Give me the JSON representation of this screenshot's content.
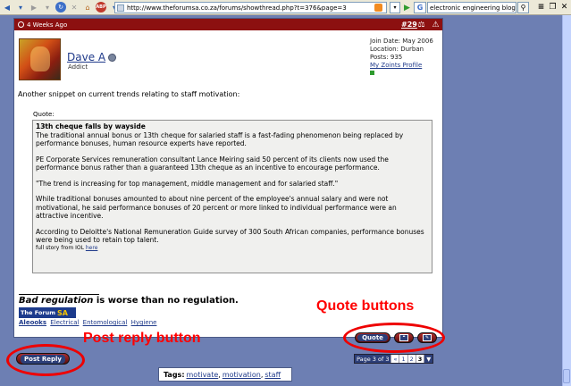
{
  "browser": {
    "url": "http://www.theforumsa.co.za/forums/showthread.php?t=376&page=3",
    "search_value": "electronic engineering blog",
    "search_engine_letter": "G",
    "addon_label": "ABP"
  },
  "post": {
    "time": "4 Weeks Ago",
    "number": "#29",
    "username": "Dave A",
    "user_title": "Addict",
    "join_date": "Join Date: May 2006",
    "location": "Location: Durban",
    "posts": "Posts: 935",
    "zoints_link": "My Zoints Profile",
    "intro": "Another snippet on current trends relating to staff motivation:",
    "quote_label": "Quote:",
    "quote": {
      "title": "13th cheque falls by wayside",
      "p1": "The traditional annual bonus or 13th cheque for salaried staff is a fast-fading phenomenon being replaced by performance bonuses, human resource experts have reported.",
      "p2": "PE Corporate Services remuneration consultant Lance Meiring said 50 percent of its clients now used the performance bonus rather than a guaranteed 13th cheque as an incentive to encourage performance.",
      "p3": "\"The trend is increasing for top management, middle management and for salaried staff.\"",
      "p4": "While traditional bonuses amounted to about nine percent of the employee's annual salary and were not motivational, he said performance bonuses of 20 percent or more linked to individual performance were an attractive incentive.",
      "p5": "According to Deloitte's National Remuneration Guide survey of 300 South African companies, performance bonuses were being used to retain top talent.",
      "source": "full story from IOL",
      "source_link": "here"
    },
    "signature": {
      "bold_italic": "Bad regulation",
      "rest": " is worse than no regulation.",
      "logo_text": "The Forum",
      "logo_sa": "SA",
      "links": [
        "Aleooks",
        "Electrical",
        "Entomological",
        "Hygiene"
      ]
    }
  },
  "buttons": {
    "quote": "Quote",
    "post_reply": "Post Reply"
  },
  "pagination": {
    "label": "Page 3 of 3",
    "pages": [
      "«",
      "1",
      "2",
      "3"
    ]
  },
  "tags": {
    "label": "Tags:",
    "items": [
      "motivate",
      "motivation",
      "staff"
    ]
  },
  "annotations": {
    "quote_buttons": "Quote buttons",
    "post_reply": "Post reply button"
  }
}
